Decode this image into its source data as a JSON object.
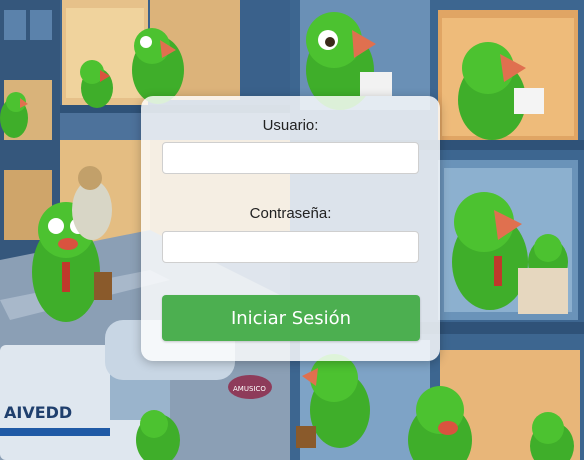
{
  "login": {
    "username_label": "Usuario:",
    "username_value": "",
    "password_label": "Contraseña:",
    "password_value": "",
    "submit_label": "Iniciar Sesión"
  },
  "background": {
    "description_colors": {
      "building": "#3f6690",
      "window_warm": "#e2b16e",
      "parrot_green": "#3fae2a",
      "beak": "#e0704f",
      "street": "#8d9fb3"
    },
    "van_text": "AIVEDD",
    "sign_text": "AMUSICO"
  }
}
